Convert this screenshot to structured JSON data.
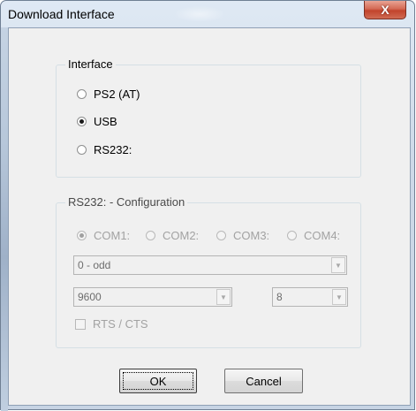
{
  "window": {
    "title": "Download Interface",
    "close_symbol": "X"
  },
  "interface_group": {
    "legend": "Interface",
    "options": [
      {
        "label": "PS2 (AT)",
        "checked": false
      },
      {
        "label": "USB",
        "checked": true
      },
      {
        "label": "RS232:",
        "checked": false
      }
    ]
  },
  "rs232_group": {
    "legend": "RS232: - Configuration",
    "ports": [
      {
        "label": "COM1:",
        "checked": true
      },
      {
        "label": "COM2:",
        "checked": false
      },
      {
        "label": "COM3:",
        "checked": false
      },
      {
        "label": "COM4:",
        "checked": false
      }
    ],
    "parity": {
      "value": "0 - odd"
    },
    "baud": {
      "value": "9600"
    },
    "databits": {
      "value": "8"
    },
    "rts_cts": {
      "label": "RTS / CTS",
      "checked": false
    }
  },
  "buttons": {
    "ok": "OK",
    "cancel": "Cancel"
  },
  "icons": {
    "close": "close-icon",
    "dropdown": "chevron-down-icon"
  }
}
